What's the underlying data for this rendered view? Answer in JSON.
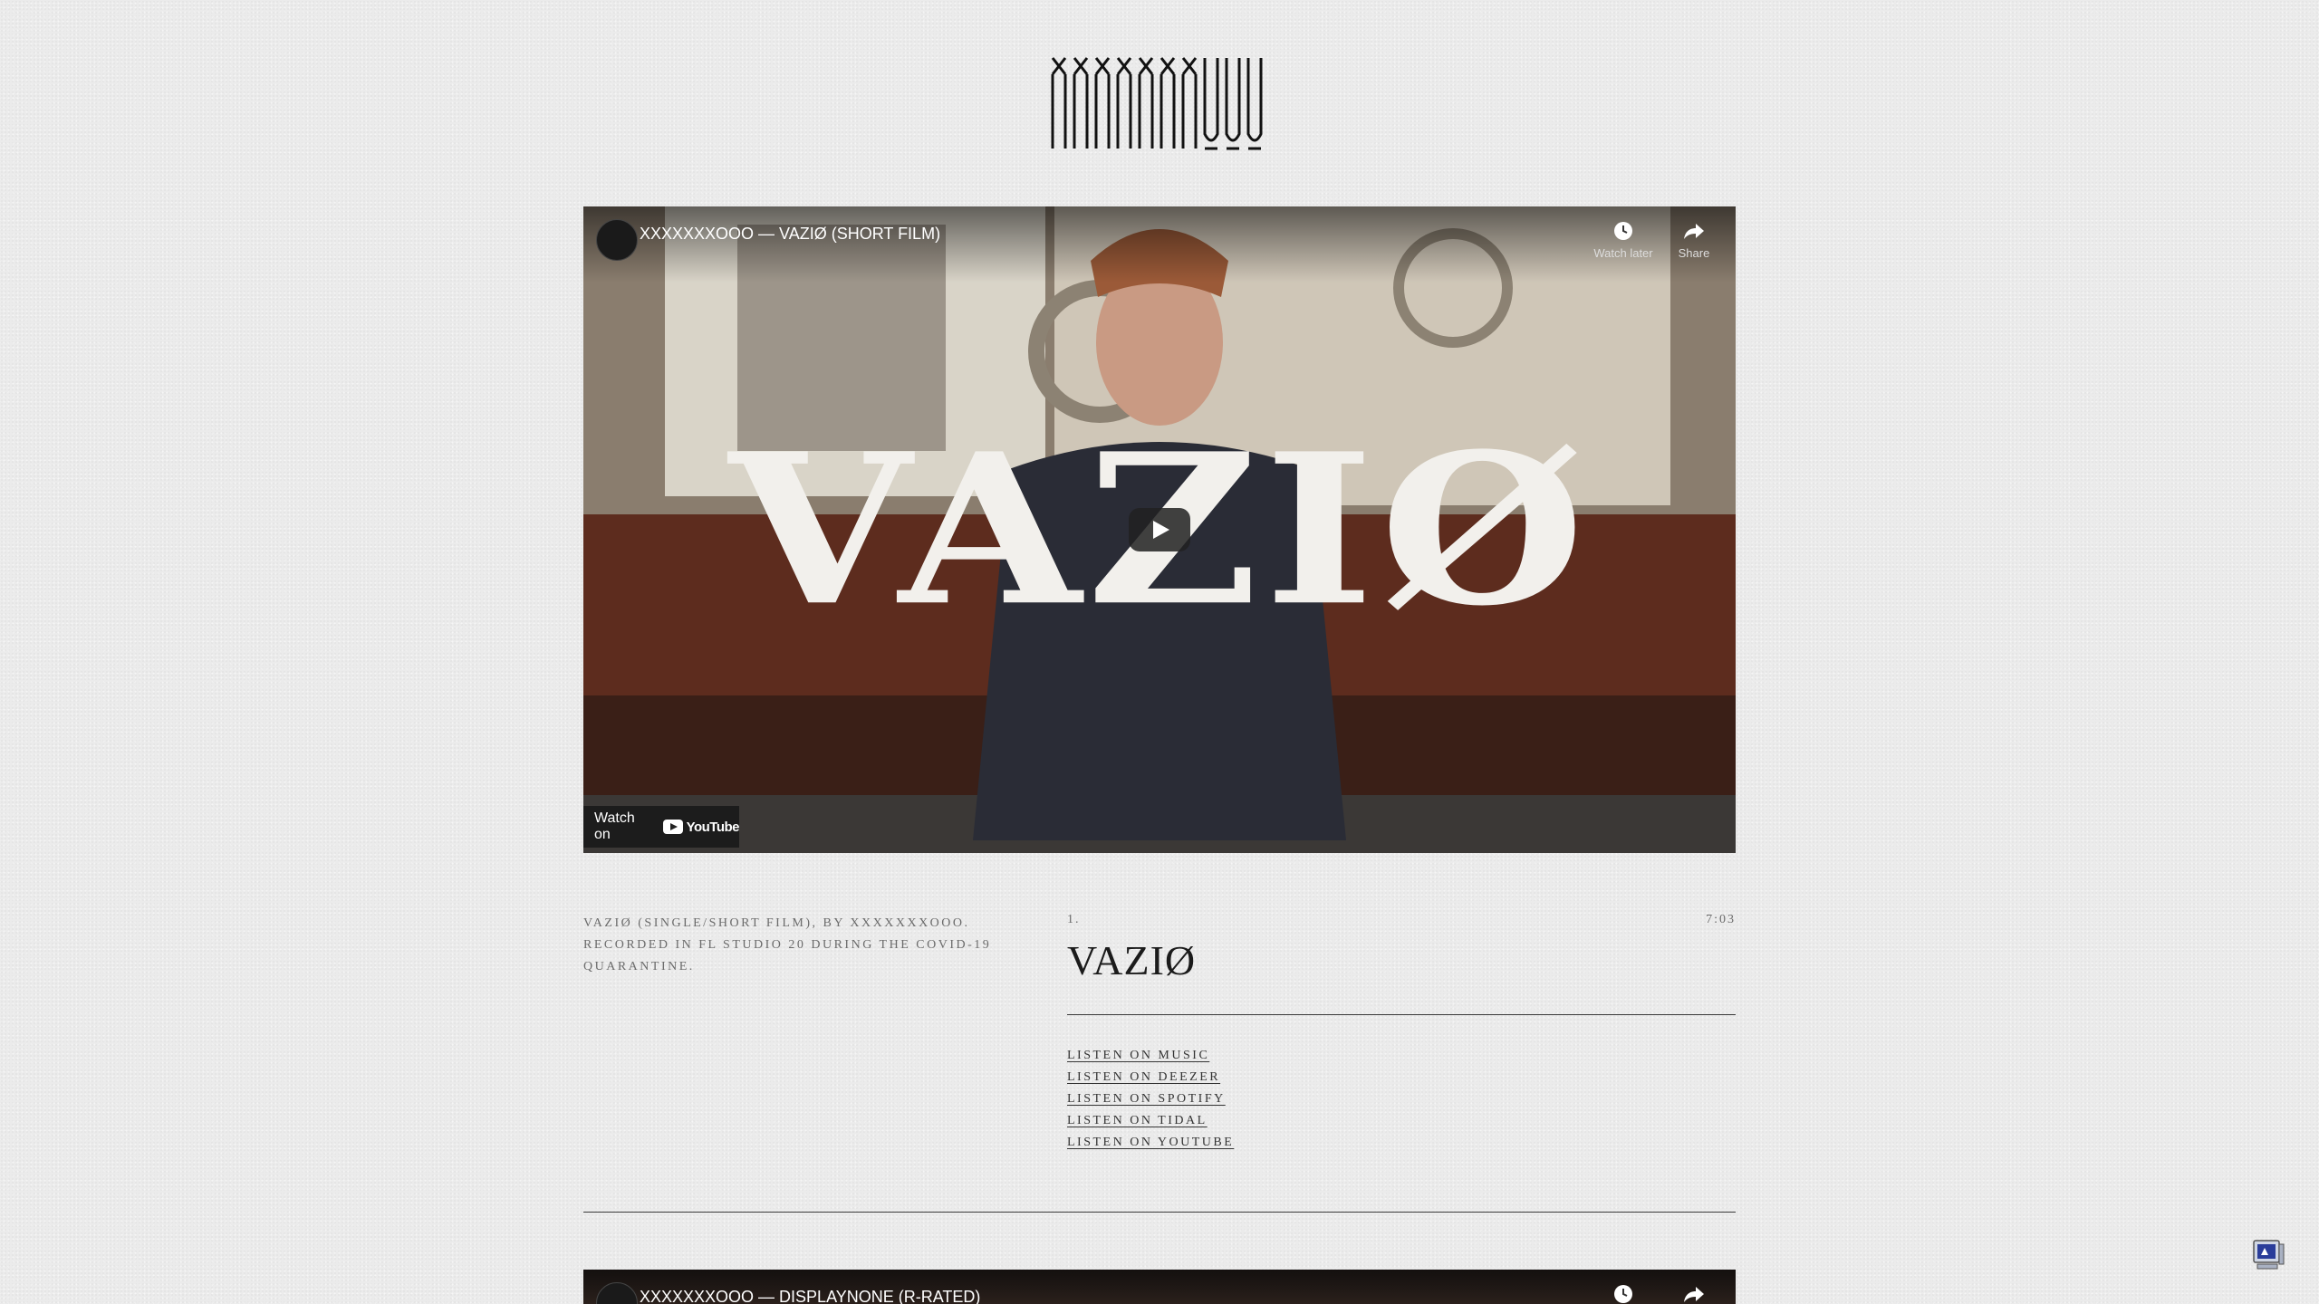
{
  "logo": {
    "alt": "XXXXXXXOOO"
  },
  "videos": [
    {
      "title": "XXXXXXXOOO — VAZIØ (SHORT FILM)",
      "watch_later": "Watch later",
      "share": "Share",
      "watch_on": "Watch on",
      "youtube": "YouTube",
      "overlay_text": "VAZIØ"
    },
    {
      "title": "XXXXXXXOOO — DISPLAYNONE (R-RATED)"
    }
  ],
  "release": {
    "description": "VAZIØ (SINGLE/SHORT FILM), BY XXXXXXXOOO. RECORDED IN FL STUDIO 20 DURING THE COVID-19 QUARANTINE.",
    "track_number": "1.",
    "track_title": "VAZIØ",
    "duration": "7:03",
    "links": [
      "LISTEN ON  MUSIC",
      "LISTEN ON DEEZER",
      "LISTEN ON SPOTIFY",
      "LISTEN ON TIDAL",
      "LISTEN ON YOUTUBE"
    ]
  }
}
